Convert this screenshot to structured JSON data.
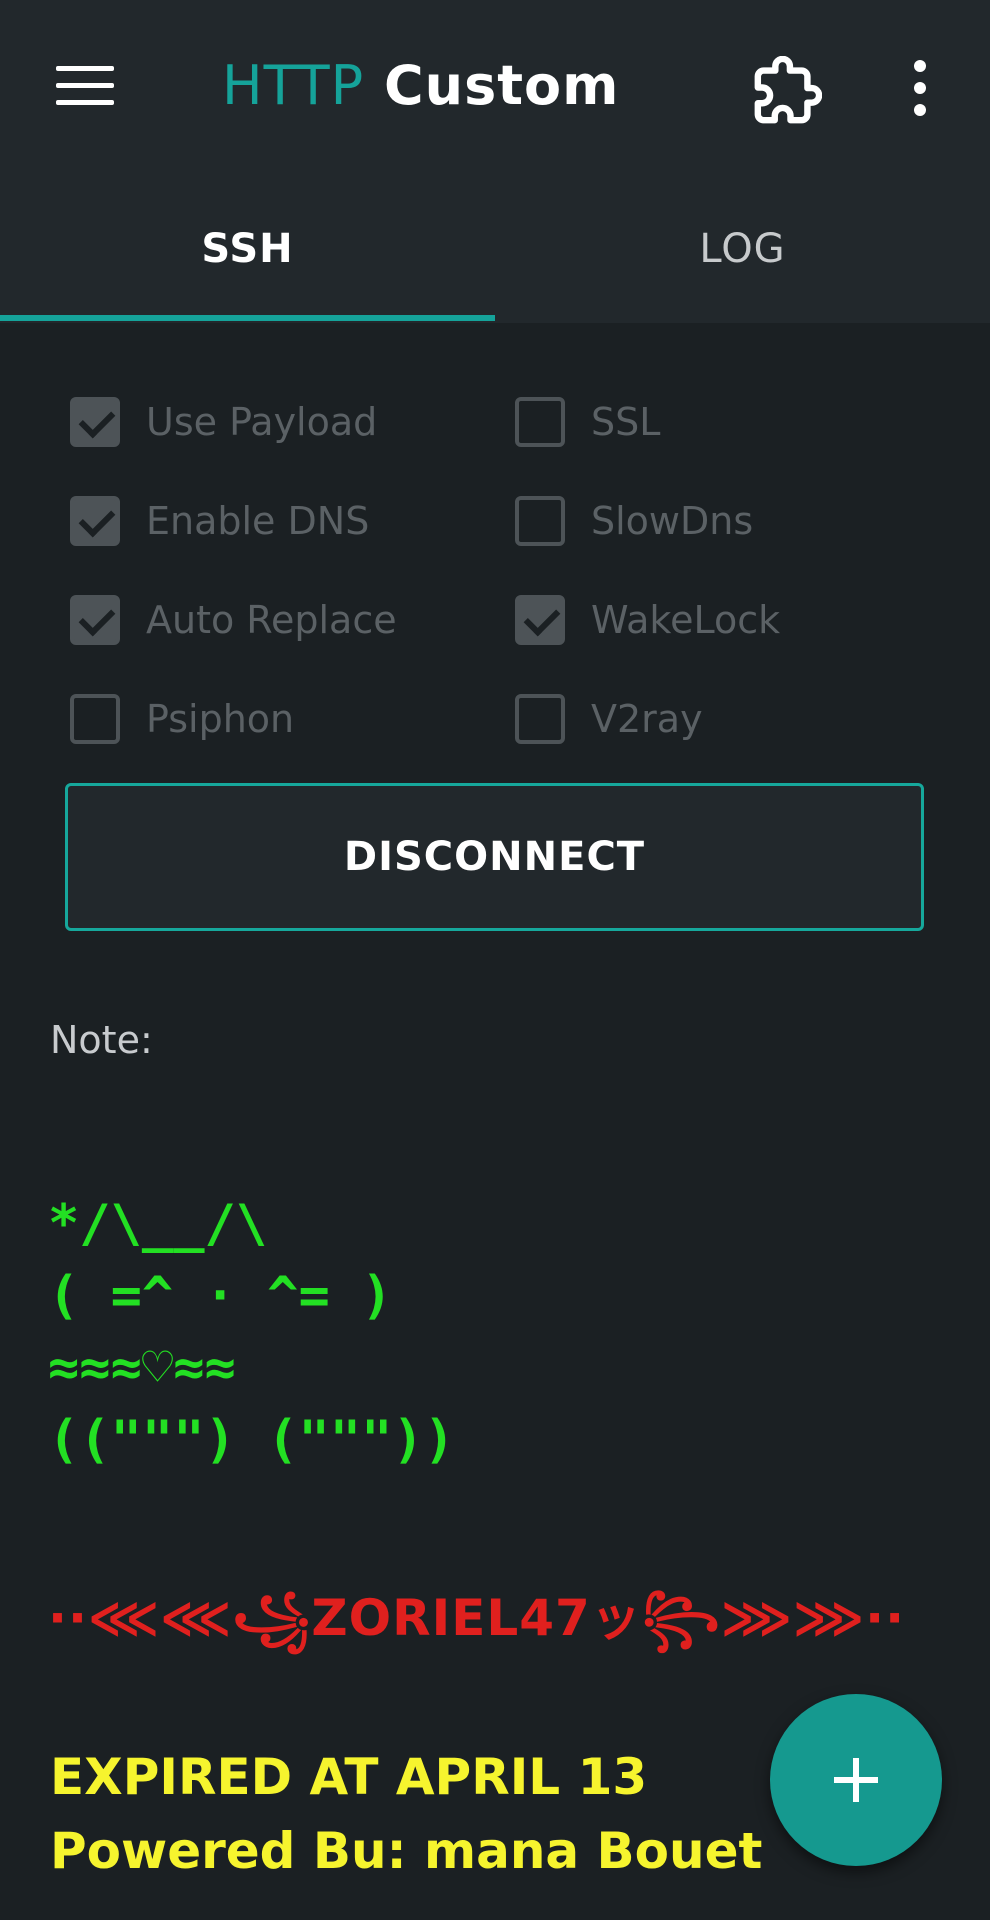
{
  "app": {
    "title_accent": "HTTP",
    "title_main": "Custom"
  },
  "toolbar": {
    "menu_icon": "hamburger-menu-icon",
    "plugin_icon": "puzzle-piece-icon",
    "more_icon": "vertical-dots-icon"
  },
  "tabs": [
    {
      "label": "SSH",
      "selected": true
    },
    {
      "label": "LOG",
      "selected": false
    }
  ],
  "options": [
    {
      "label": "Use Payload",
      "checked": true
    },
    {
      "label": "SSL",
      "checked": false
    },
    {
      "label": "Enable DNS",
      "checked": true
    },
    {
      "label": "SlowDns",
      "checked": false
    },
    {
      "label": "Auto Replace",
      "checked": true
    },
    {
      "label": "WakeLock",
      "checked": true
    },
    {
      "label": "Psiphon",
      "checked": false
    },
    {
      "label": "V2ray",
      "checked": false
    }
  ],
  "main": {
    "disconnect_label": "DISCONNECT",
    "note_label": "Note:"
  },
  "note": {
    "cat_line1": "*/\\__/\\",
    "cat_line2": "( =^ · ^= )",
    "cat_line3": "≈≈≈♡≈≈",
    "cat_line4": "((\"\"\") (\"\"\"))",
    "signature": "··⋘⋘꧁ZORIEL47ッ꧂⋙⋙··",
    "expired": "EXPIRED AT APRIL 13",
    "powered": "Powered Bu: mana Bouet"
  },
  "fab": {
    "icon": "plus-icon"
  },
  "colors": {
    "accent": "#15a39a",
    "cat_green": "#23e023",
    "signature_red": "#e0201e",
    "expiry_yellow": "#f6f42e"
  }
}
